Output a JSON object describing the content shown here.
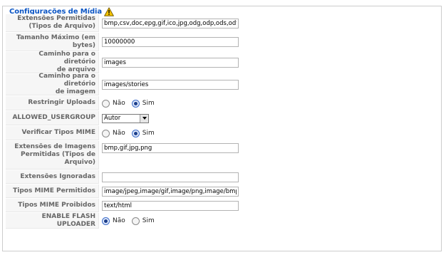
{
  "legend": {
    "title": "Configurações de Mídia",
    "icon": "warning-icon"
  },
  "colors": {
    "legend": "#0b55c4",
    "label_bg": "#f6f6f6",
    "warning": "#f2c200"
  },
  "fields": {
    "allowed_extensions": {
      "label_line1": "Extensões Permitidas",
      "label_line2": "(Tipos de Arquivo)",
      "value": "bmp,csv,doc,epg,gif,ico,jpg,odg,odp,ods,odt,p"
    },
    "max_size": {
      "label_line1": "Tamanho Máximo (em",
      "label_line2": "bytes)",
      "value": "10000000"
    },
    "file_path": {
      "label_line1": "Caminho para o diretório",
      "label_line2": "de arquivo",
      "value": "images"
    },
    "image_path": {
      "label_line1": "Caminho para o diretório",
      "label_line2": "de imagem",
      "value": "images/stories"
    },
    "restrict_uploads": {
      "label": "Restringir Uploads",
      "option_no": "Não",
      "option_yes": "Sim",
      "selected": "Sim"
    },
    "allowed_usergroup": {
      "label": "ALLOWED_USERGROUP",
      "value": "Autor"
    },
    "check_mime": {
      "label": "Verificar Tipos MIME",
      "option_no": "Não",
      "option_yes": "Sim",
      "selected": "Sim"
    },
    "image_extensions": {
      "label_line1": "Extensões de Imagens",
      "label_line2": "Permitidas (Tipos de",
      "label_line3": "Arquivo)",
      "value": "bmp,gif,jpg,png"
    },
    "ignored_extensions": {
      "label": "Extensões Ignoradas",
      "value": ""
    },
    "allowed_mime": {
      "label": "Tipos MIME Permitidos",
      "value": "image/jpeg,image/gif,image/png,image/bmp,ap"
    },
    "forbidden_mime": {
      "label": "Tipos MIME Proibidos",
      "value": "text/html"
    },
    "flash_uploader": {
      "label": "ENABLE FLASH UPLOADER",
      "option_no": "Não",
      "option_yes": "Sim",
      "selected": "Não"
    }
  }
}
